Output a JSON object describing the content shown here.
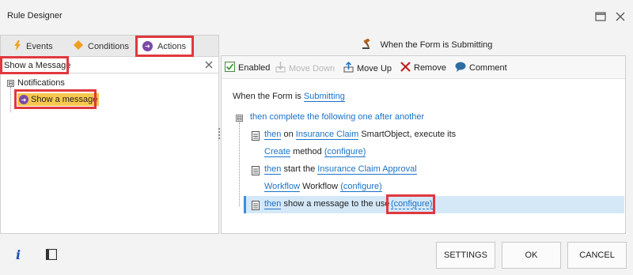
{
  "window": {
    "title": "Rule Designer",
    "maximize_icon": "maximize-icon",
    "close_icon": "close-icon"
  },
  "tabs": [
    {
      "label": "Events",
      "icon": "lightning-icon"
    },
    {
      "label": "Conditions",
      "icon": "diamond-icon"
    },
    {
      "label": "Actions",
      "icon": "arrow-circle-icon",
      "active": true
    }
  ],
  "search": {
    "value": "Show a Message",
    "placeholder": ""
  },
  "tree": {
    "group": {
      "label": "Notifications",
      "expander": "⊟"
    },
    "leaf": {
      "label": "Show a message"
    }
  },
  "rule_header": {
    "label": "When the Form is Submitting",
    "icon": "gavel-icon"
  },
  "toolbar": {
    "enabled": "Enabled",
    "move_down": "Move Down",
    "move_up": "Move Up",
    "remove": "Remove",
    "comment": "Comment"
  },
  "rule": {
    "when_prefix": "When the Form is",
    "when_event": "Submitting",
    "group_label": "then complete the following one after another",
    "step1": {
      "then": "then",
      "on": "on",
      "object": "Insurance Claim",
      "rest": "SmartObject, execute its",
      "method": "Create",
      "method_word": "method",
      "configure": "(configure)"
    },
    "step2": {
      "then": "then",
      "start": "start the",
      "workflow_name": "Insurance Claim Approval",
      "workflow": "Workflow",
      "workflow_word": "Workflow",
      "configure": "(configure)"
    },
    "step3": {
      "then": "then",
      "text": "show a message to the user",
      "configure": "(configure)"
    }
  },
  "footer": {
    "settings": "SETTINGS",
    "ok": "OK",
    "cancel": "CANCEL"
  },
  "colors": {
    "accent": "#1a73c8",
    "highlight": "#e0383e",
    "selected": "#d4e8f8",
    "leaf_bg": "#f7c84e"
  }
}
